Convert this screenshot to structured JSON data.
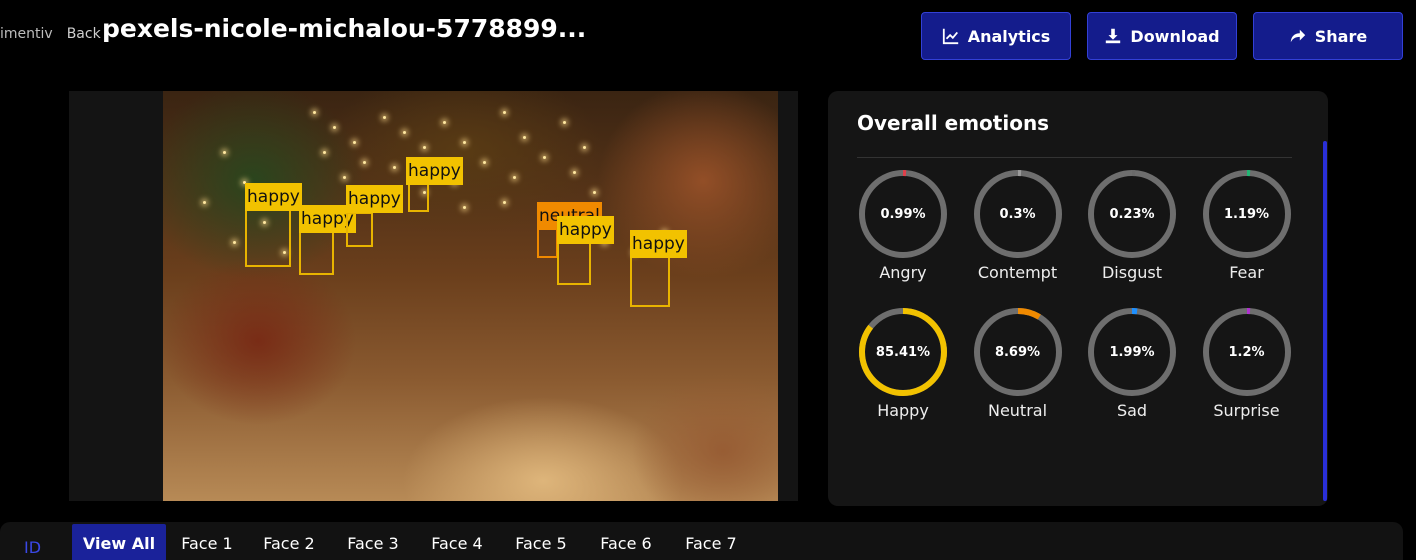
{
  "header": {
    "logo_text": "imentiv",
    "back_label": "Back",
    "file_title": "pexels-nicole-michalou-5778899..."
  },
  "toolbar": {
    "analytics_label": "Analytics",
    "download_label": "Download",
    "share_label": "Share"
  },
  "detections": [
    {
      "label": "happy"
    },
    {
      "label": "happy"
    },
    {
      "label": "happy"
    },
    {
      "label": "happy"
    },
    {
      "label": "neutral"
    },
    {
      "label": "happy"
    },
    {
      "label": "happy"
    }
  ],
  "emotions_panel": {
    "title": "Overall emotions",
    "items": [
      {
        "name": "Angry",
        "value_text": "0.99%",
        "value": 0.99,
        "color": "#e0404a"
      },
      {
        "name": "Contempt",
        "value_text": "0.3%",
        "value": 0.3,
        "color": "#9a9a9a"
      },
      {
        "name": "Disgust",
        "value_text": "0.23%",
        "value": 0.23,
        "color": "#6a6a6a"
      },
      {
        "name": "Fear",
        "value_text": "1.19%",
        "value": 1.19,
        "color": "#22b573"
      },
      {
        "name": "Happy",
        "value_text": "85.41%",
        "value": 85.41,
        "color": "#f2c200"
      },
      {
        "name": "Neutral",
        "value_text": "8.69%",
        "value": 8.69,
        "color": "#f08a00"
      },
      {
        "name": "Sad",
        "value_text": "1.99%",
        "value": 1.99,
        "color": "#1e90ff"
      },
      {
        "name": "Surprise",
        "value_text": "1.2%",
        "value": 1.2,
        "color": "#b030d0"
      }
    ]
  },
  "tabs": {
    "id_label": "ID",
    "items": [
      {
        "label": "View All",
        "active": true
      },
      {
        "label": "Face 1"
      },
      {
        "label": "Face 2"
      },
      {
        "label": "Face 3"
      },
      {
        "label": "Face 4"
      },
      {
        "label": "Face 5"
      },
      {
        "label": "Face 6"
      },
      {
        "label": "Face 7"
      }
    ]
  },
  "colors": {
    "accent": "#141c8c",
    "accent_border": "#3340d6",
    "happy_box": "#f2c200",
    "neutral_box": "#f08a00",
    "gauge_track": "#6e6e6e"
  }
}
